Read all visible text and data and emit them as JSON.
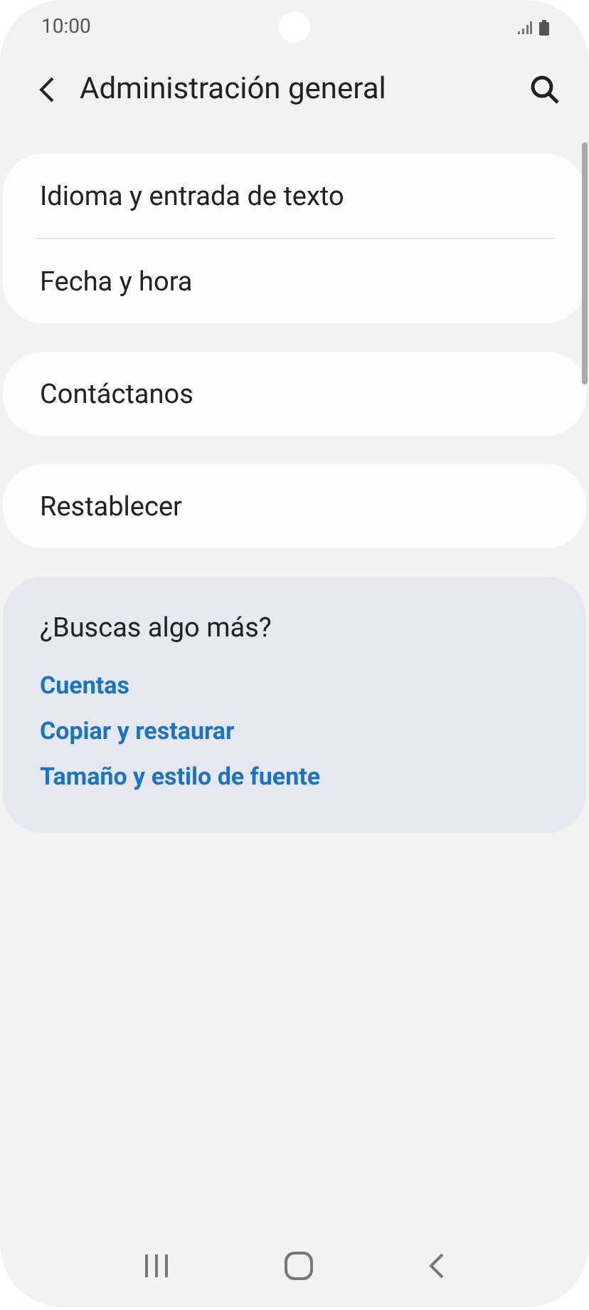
{
  "status_bar": {
    "time": "10:00"
  },
  "header": {
    "title": "Administración general"
  },
  "groups": [
    {
      "items": [
        {
          "label": "Idioma y entrada de texto"
        },
        {
          "label": "Fecha y hora"
        }
      ]
    },
    {
      "items": [
        {
          "label": "Contáctanos"
        }
      ]
    },
    {
      "items": [
        {
          "label": "Restablecer"
        }
      ]
    }
  ],
  "suggestions": {
    "title": "¿Buscas algo más?",
    "links": [
      {
        "label": "Cuentas"
      },
      {
        "label": "Copiar y restaurar"
      },
      {
        "label": "Tamaño y estilo de fuente"
      }
    ]
  }
}
